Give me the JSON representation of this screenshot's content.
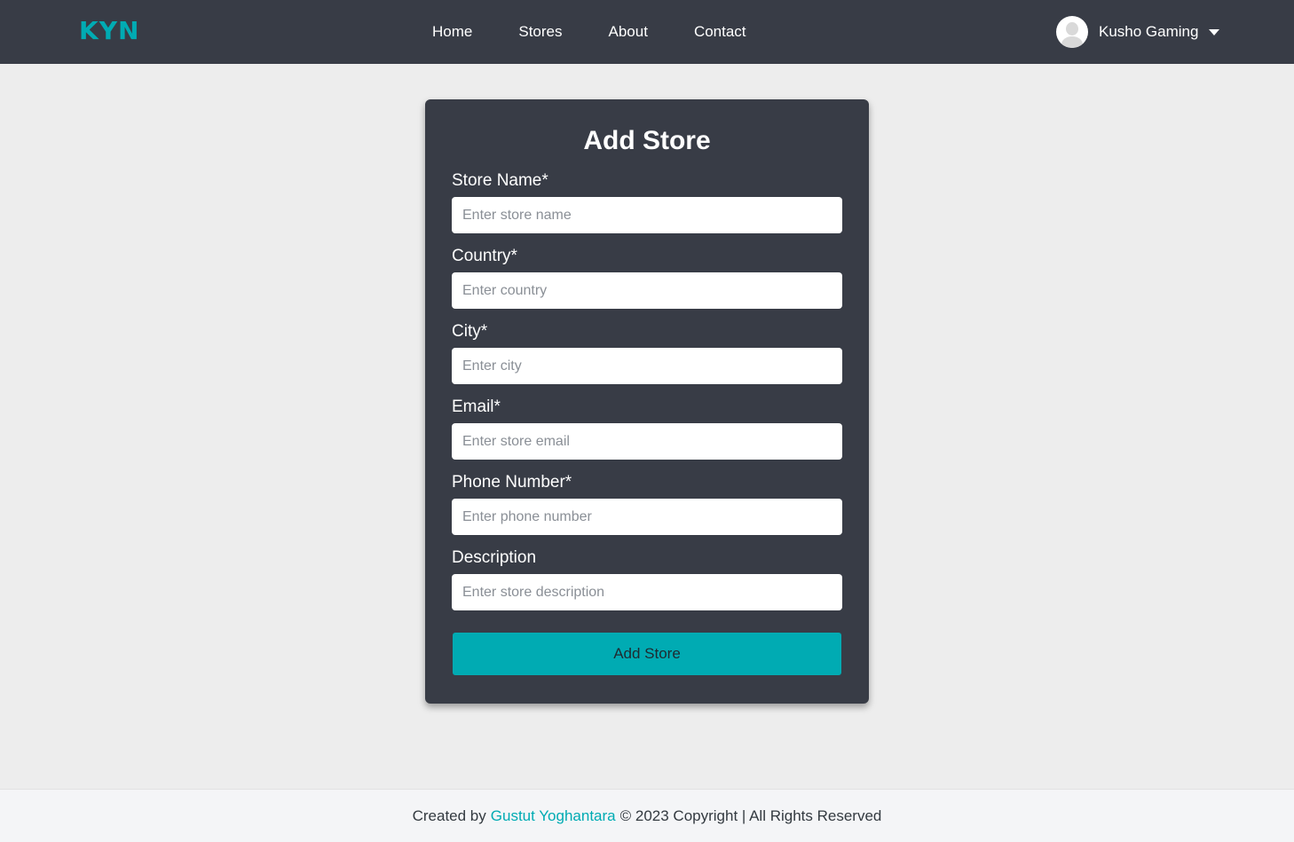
{
  "navbar": {
    "brand": "KYN",
    "links": [
      {
        "label": "Home"
      },
      {
        "label": "Stores"
      },
      {
        "label": "About"
      },
      {
        "label": "Contact"
      }
    ],
    "user": {
      "name": "Kusho Gaming",
      "avatar_icon": "user-avatar-icon",
      "caret_icon": "caret-down-icon"
    }
  },
  "form": {
    "title": "Add Store",
    "fields": [
      {
        "label": "Store Name*",
        "placeholder": "Enter store name",
        "value": ""
      },
      {
        "label": "Country*",
        "placeholder": "Enter country",
        "value": ""
      },
      {
        "label": "City*",
        "placeholder": "Enter city",
        "value": ""
      },
      {
        "label": "Email*",
        "placeholder": "Enter store email",
        "value": ""
      },
      {
        "label": "Phone Number*",
        "placeholder": "Enter phone number",
        "value": ""
      },
      {
        "label": "Description",
        "placeholder": "Enter store description",
        "value": ""
      }
    ],
    "submit_label": "Add Store"
  },
  "footer": {
    "prefix": "Created by",
    "author": "Gustut Yoghantara",
    "suffix": "© 2023 Copyright | All Rights Reserved"
  },
  "colors": {
    "navbar_bg": "#383c46",
    "accent": "#00abb3",
    "page_bg": "#ededed",
    "card_bg": "#383c46"
  }
}
